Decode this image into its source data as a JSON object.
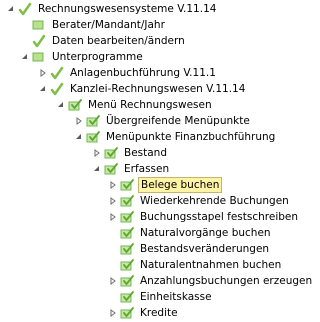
{
  "tree": {
    "root": {
      "label": "Rechnungswesensysteme V.11.14",
      "icon": "checkmark-icon",
      "expanded": true
    },
    "items": [
      {
        "label": "Berater/Mandant/Jahr",
        "icon": "square-doc-icon"
      },
      {
        "label": "Daten bearbeiten/ändern",
        "icon": "checkmark-icon"
      },
      {
        "label": "Unterprogramme",
        "icon": "square-doc-icon",
        "expanded": true
      },
      {
        "label": "Anlagenbuchführung V.11.1",
        "icon": "checkmark-icon",
        "expanded": false
      },
      {
        "label": "Kanzlei-Rechnungswesen V.11.14",
        "icon": "checkmark-icon",
        "expanded": true
      },
      {
        "label": "Menü Rechnungswesen",
        "icon": "doc-check-icon",
        "expanded": true
      },
      {
        "label": "Übergreifende Menüpunkte",
        "icon": "doc-check-icon",
        "expanded": false
      },
      {
        "label": "Menüpunkte Finanzbuchführung",
        "icon": "doc-check-icon",
        "expanded": true
      },
      {
        "label": "Bestand",
        "icon": "doc-check-icon",
        "expanded": false
      },
      {
        "label": "Erfassen",
        "icon": "doc-check-icon",
        "expanded": true
      },
      {
        "label": "Belege buchen",
        "icon": "doc-check-icon",
        "expanded": false,
        "selected": true
      },
      {
        "label": "Wiederkehrende Buchungen",
        "icon": "doc-check-icon",
        "expanded": false
      },
      {
        "label": "Buchungsstapel festschreiben",
        "icon": "doc-check-icon",
        "expanded": false
      },
      {
        "label": "Naturalvorgänge buchen",
        "icon": "doc-check-icon"
      },
      {
        "label": "Bestandsveränderungen",
        "icon": "doc-check-icon"
      },
      {
        "label": "Naturalentnahmen buchen",
        "icon": "doc-check-icon"
      },
      {
        "label": "Anzahlungsbuchungen erzeugen",
        "icon": "doc-check-icon",
        "expanded": false
      },
      {
        "label": "Einheitskasse",
        "icon": "doc-check-icon"
      },
      {
        "label": "Kredite",
        "icon": "doc-check-icon",
        "expanded": false
      }
    ]
  },
  "colors": {
    "check_green": "#7bc043",
    "doc_green": "#6fb84a",
    "selection_bg": "#fff3a6",
    "expander": "#6e6e6e"
  }
}
